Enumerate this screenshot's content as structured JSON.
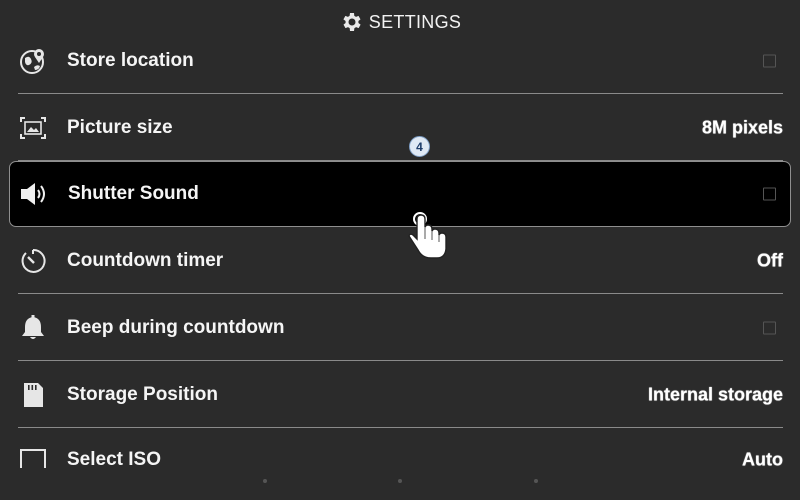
{
  "header": {
    "title": "SETTINGS",
    "icon": "gear-icon"
  },
  "settings": [
    {
      "label": "Store location",
      "icon": "location-globe-icon",
      "control": "checkbox",
      "checked": false
    },
    {
      "label": "Picture size",
      "icon": "picture-size-icon",
      "control": "value",
      "value": "8M pixels"
    },
    {
      "label": "Shutter Sound",
      "icon": "speaker-icon",
      "control": "checkbox",
      "checked": false,
      "selected": true
    },
    {
      "label": "Countdown timer",
      "icon": "timer-icon",
      "control": "value",
      "value": "Off"
    },
    {
      "label": "Beep during countdown",
      "icon": "bell-icon",
      "control": "checkbox",
      "checked": false
    },
    {
      "label": "Storage Position",
      "icon": "sd-card-icon",
      "control": "value",
      "value": "Internal storage"
    },
    {
      "label": "Select ISO",
      "icon": "iso-icon",
      "control": "value",
      "value": "Auto"
    }
  ],
  "touch": {
    "step": "4"
  },
  "colors": {
    "background": "#2b2b2b",
    "selected_row": "#000000",
    "divider": "#8a8a8a"
  }
}
